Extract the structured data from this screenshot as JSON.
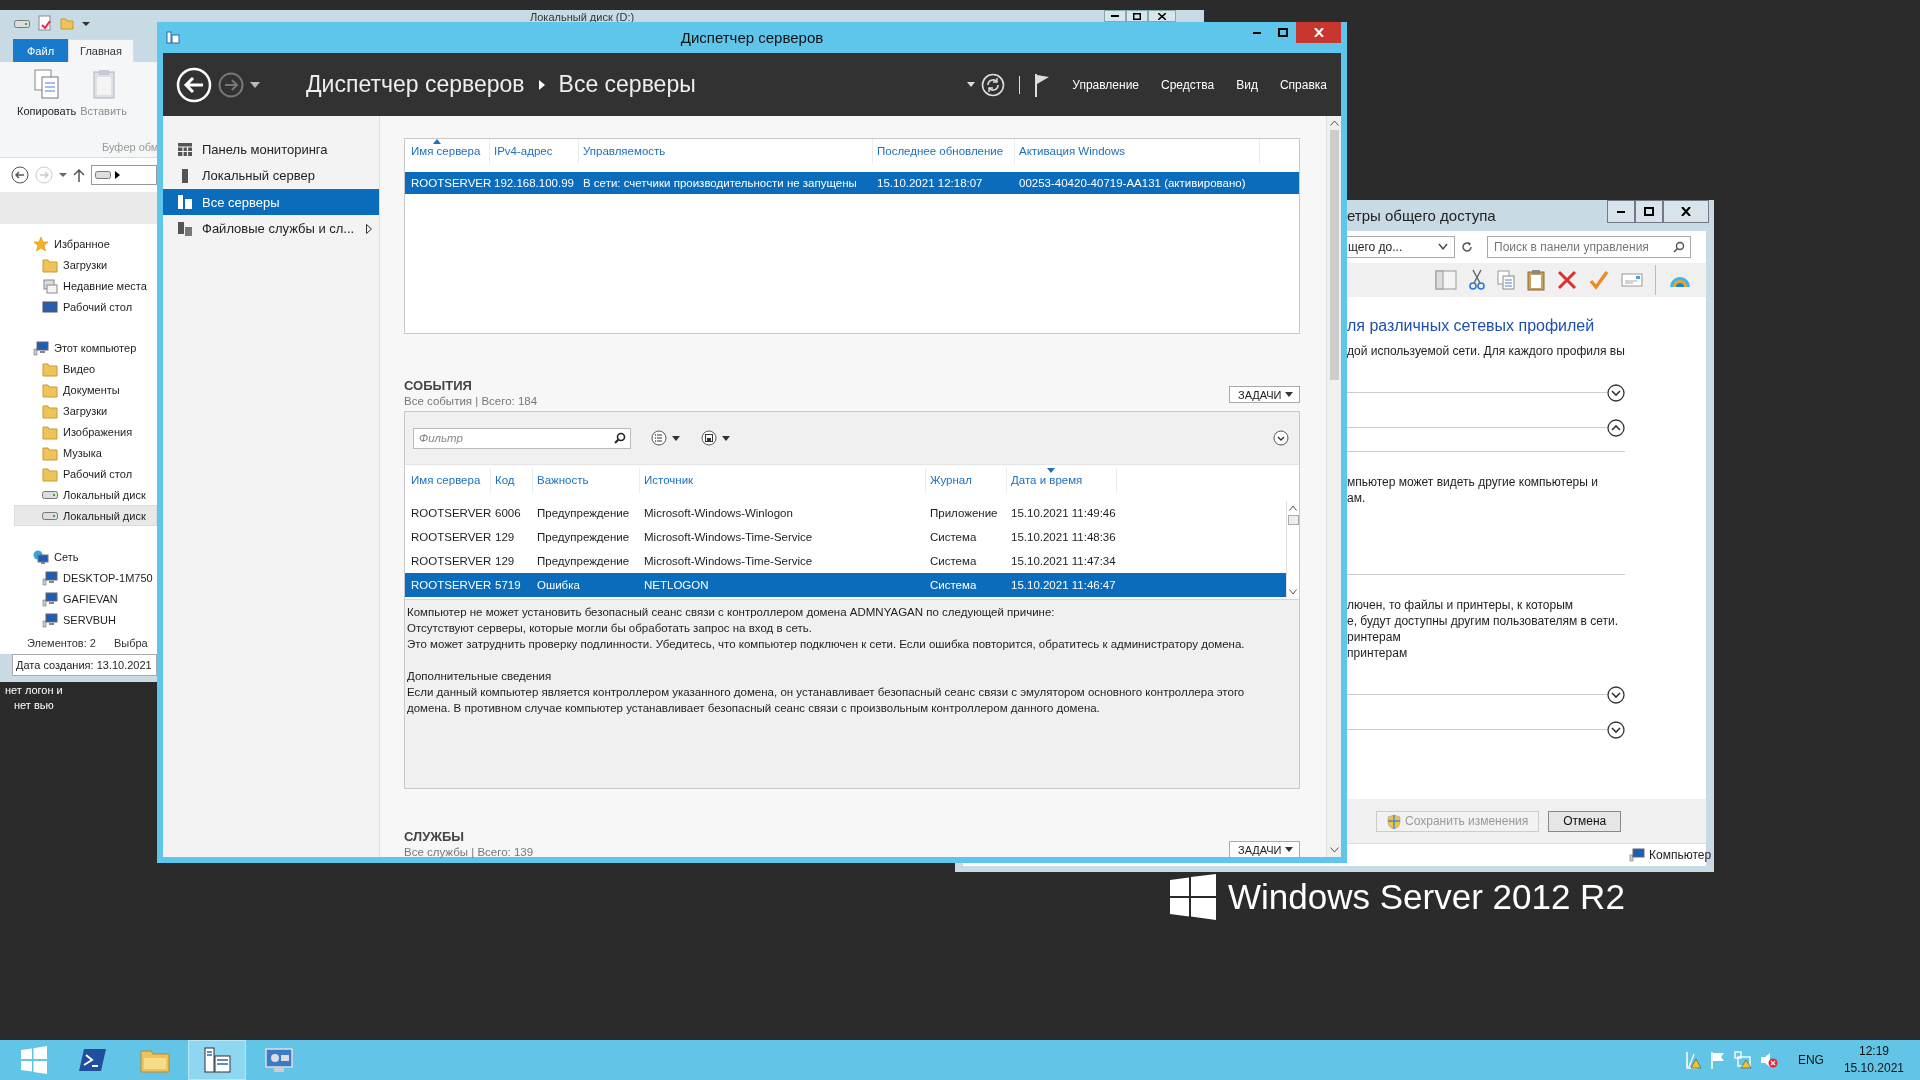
{
  "desktop": {
    "label_lines": [
      "нет логон и",
      "нет вью"
    ]
  },
  "explorer": {
    "title": "Локальный диск (D:)",
    "ribbon_tabs": [
      {
        "label": "Файл",
        "kind": "file",
        "selected": false
      },
      {
        "label": "Главная",
        "kind": "tab",
        "selected": true
      }
    ],
    "ribbon_buttons": [
      {
        "label": "Копировать",
        "kind": "copy",
        "disabled": false
      },
      {
        "label": "Вставить",
        "kind": "paste",
        "disabled": true
      }
    ],
    "ribbon_group": "Буфер обм",
    "tree": [
      {
        "label": "Избранное",
        "kind": "star",
        "selected": false,
        "children": [
          {
            "label": "Загрузки",
            "kind": "folder",
            "selected": false
          },
          {
            "label": "Недавние места",
            "kind": "recent",
            "selected": false
          },
          {
            "label": "Рабочий стол",
            "kind": "desktop",
            "selected": false
          }
        ]
      },
      {
        "label": "Этот компьютер",
        "kind": "computer",
        "selected": false,
        "children": [
          {
            "label": "Видео",
            "kind": "folder",
            "selected": false
          },
          {
            "label": "Документы",
            "kind": "folder",
            "selected": false
          },
          {
            "label": "Загрузки",
            "kind": "folder",
            "selected": false
          },
          {
            "label": "Изображения",
            "kind": "folder",
            "selected": false
          },
          {
            "label": "Музыка",
            "kind": "folder",
            "selected": false
          },
          {
            "label": "Рабочий стол",
            "kind": "folder",
            "selected": false
          },
          {
            "label": "Локальный диск",
            "kind": "drive",
            "selected": false
          },
          {
            "label": "Локальный диск",
            "kind": "drive",
            "selected": true
          }
        ]
      },
      {
        "label": "Сеть",
        "kind": "network",
        "selected": false,
        "children": [
          {
            "label": "DESKTOP-1M750",
            "kind": "computer",
            "selected": false
          },
          {
            "label": "GAFIEVAN",
            "kind": "computer",
            "selected": false
          },
          {
            "label": "SERVBUH",
            "kind": "computer",
            "selected": false
          }
        ]
      }
    ],
    "status_items": "Элементов: 2",
    "status_selection": "Выбра",
    "details": "Дата создания: 13.10.2021"
  },
  "server_manager": {
    "title": "Диспетчер серверов",
    "breadcrumb": [
      "Диспетчер серверов",
      "Все серверы"
    ],
    "menu": [
      "Управление",
      "Средства",
      "Вид",
      "Справка"
    ],
    "nav": [
      {
        "label": "Панель мониторинга",
        "kind": "dashboard",
        "selected": false,
        "submenu": false
      },
      {
        "label": "Локальный сервер",
        "kind": "server",
        "selected": false,
        "submenu": false
      },
      {
        "label": "Все серверы",
        "kind": "servers",
        "selected": true,
        "submenu": false
      },
      {
        "label": "Файловые службы и сл...",
        "kind": "files",
        "selected": false,
        "submenu": true
      }
    ],
    "servers": {
      "columns": [
        {
          "label": "Имя сервера",
          "sorted": true,
          "descending": false
        },
        {
          "label": "IPv4-адрес",
          "sorted": false
        },
        {
          "label": "Управляемость",
          "sorted": false
        },
        {
          "label": "Последнее обновление",
          "sorted": false
        },
        {
          "label": "Активация Windows",
          "sorted": false
        }
      ],
      "rows": [
        {
          "selected": true,
          "cells": [
            "ROOTSERVER",
            "192.168.100.99",
            "В сети: счетчики производительности не запущены",
            "15.10.2021 12:18:07",
            "00253-40420-40719-AA131 (активировано)"
          ]
        }
      ]
    },
    "events": {
      "title": "СОБЫТИЯ",
      "subtitle": "Все события | Всего: 184",
      "tasks": "ЗАДАЧИ",
      "filter_placeholder": "Фильтр",
      "columns": [
        {
          "label": "Имя сервера",
          "sorted": false
        },
        {
          "label": "Код",
          "sorted": false
        },
        {
          "label": "Важность",
          "sorted": false
        },
        {
          "label": "Источник",
          "sorted": false
        },
        {
          "label": "Журнал",
          "sorted": false
        },
        {
          "label": "Дата и время",
          "sorted": true,
          "descending": true
        }
      ],
      "rows": [
        {
          "selected": false,
          "cells": [
            "ROOTSERVER",
            "6006",
            "Предупреждение",
            "Microsoft-Windows-Winlogon",
            "Приложение",
            "15.10.2021 11:49:46"
          ]
        },
        {
          "selected": false,
          "cells": [
            "ROOTSERVER",
            "129",
            "Предупреждение",
            "Microsoft-Windows-Time-Service",
            "Система",
            "15.10.2021 11:48:36"
          ]
        },
        {
          "selected": false,
          "cells": [
            "ROOTSERVER",
            "129",
            "Предупреждение",
            "Microsoft-Windows-Time-Service",
            "Система",
            "15.10.2021 11:47:34"
          ]
        },
        {
          "selected": true,
          "cells": [
            "ROOTSERVER",
            "5719",
            "Ошибка",
            "NETLOGON",
            "Система",
            "15.10.2021 11:46:47"
          ]
        }
      ],
      "details": [
        [
          "Компьютер не может установить безопасный сеанс связи с контроллером домена ADMNYAGAN по следующей причине:",
          "Отсутствуют серверы, которые могли бы обработать запрос на вход в сеть.",
          "Это может затруднить проверку подлинности. Убедитесь, что компьютер подключен к сети. Если ошибка повторится, обратитесь к администратору домена."
        ],
        [
          "Дополнительные сведения",
          "Если данный компьютер является контроллером указанного домена, он устанавливает безопасный сеанс связи с эмулятором основного контроллера этого",
          "домена. В противном случае компьютер устанавливает безопасный сеанс связи с произвольным контроллером данного домена."
        ]
      ]
    },
    "services": {
      "title": "СЛУЖБЫ",
      "subtitle": "Все службы | Всего: 139",
      "tasks": "ЗАДАЧИ"
    }
  },
  "control_panel": {
    "title": "етры общего доступа",
    "address": "щего до...",
    "search_placeholder": "Поиск в панели управления",
    "heading": "ля различных сетевых профилей",
    "content": [
      {
        "kind": "text",
        "text": "дой используемой сети. Для каждого профиля вы"
      },
      {
        "kind": "section",
        "expanded": false
      },
      {
        "kind": "section",
        "expanded": true
      },
      {
        "kind": "rule"
      },
      {
        "kind": "text",
        "text": "мпьютер может видеть другие компьютеры и"
      },
      {
        "kind": "text",
        "text": "ам."
      },
      {
        "kind": "rule"
      },
      {
        "kind": "text",
        "text": "лючен, то файлы и принтеры, к которым"
      },
      {
        "kind": "text",
        "text": "е, будут доступны другим пользователям в сети."
      },
      {
        "kind": "text",
        "text": "ринтерам"
      },
      {
        "kind": "text",
        "text": "принтерам"
      },
      {
        "kind": "section",
        "expanded": false
      },
      {
        "kind": "section",
        "expanded": false
      }
    ],
    "buttons": [
      {
        "label": "Сохранить изменения",
        "disabled": true
      },
      {
        "label": "Отмена",
        "disabled": false
      }
    ],
    "status": "Компьютер"
  },
  "logo_text": "Windows Server 2012 R2",
  "taskbar": {
    "apps": [
      {
        "kind": "powershell",
        "selected": false
      },
      {
        "kind": "explorer",
        "selected": false
      },
      {
        "kind": "server_manager",
        "selected": true
      },
      {
        "kind": "console",
        "selected": false
      }
    ],
    "language": "ENG",
    "time": "12:19",
    "date": "15.10.2021"
  }
}
